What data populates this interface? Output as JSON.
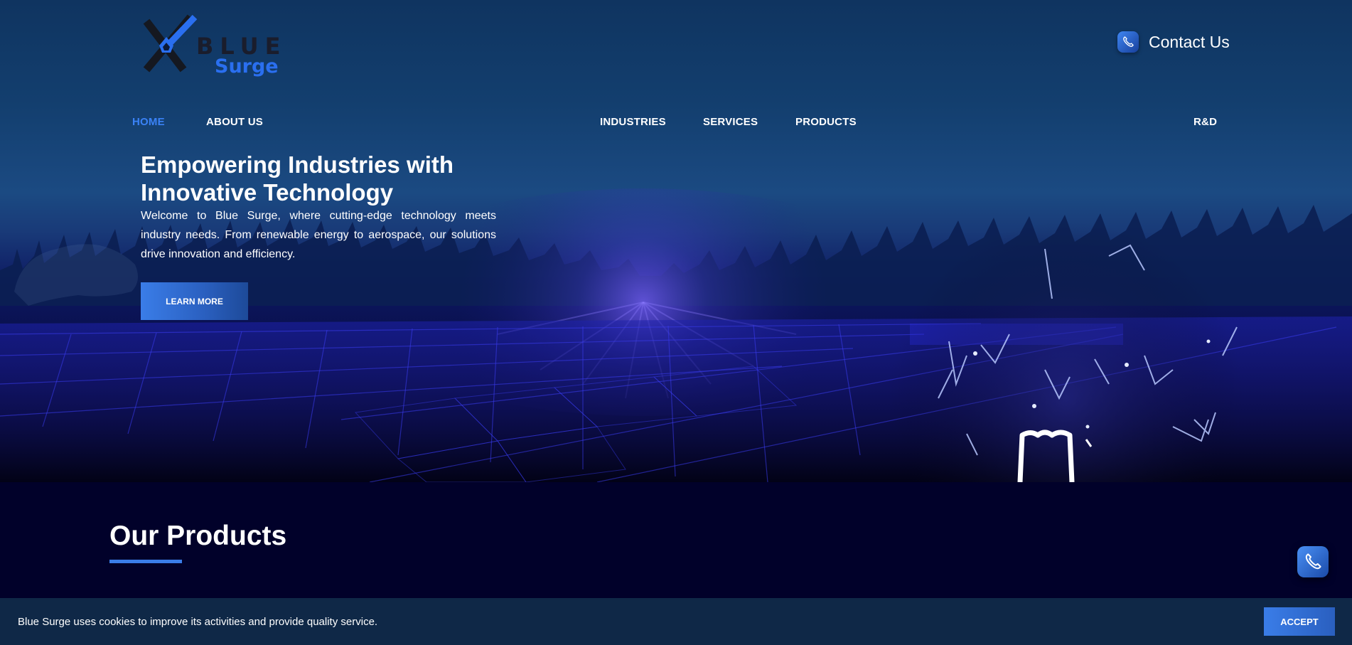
{
  "brand": {
    "word1": "BLUE",
    "word2": "Surge",
    "accent_color": "#2a6ff0",
    "dark_color": "#1a1d2c"
  },
  "header": {
    "contact_label": "Contact Us",
    "contact_icon": "phone-icon"
  },
  "nav": {
    "items": [
      {
        "label": "HOME",
        "active": true
      },
      {
        "label": "ABOUT US",
        "active": false
      },
      {
        "label": "INDUSTRIES",
        "active": false
      },
      {
        "label": "SERVICES",
        "active": false
      },
      {
        "label": "PRODUCTS",
        "active": false
      },
      {
        "label": "R&D",
        "active": false
      }
    ],
    "active_color": "#3a82f6"
  },
  "hero": {
    "title": "Empowering Industries with Innovative Technology",
    "text": "Welcome to Blue Surge, where cutting-edge technology meets industry needs. From renewable energy to aerospace, our solutions drive innovation and efficiency.",
    "cta_label": "LEARN MORE"
  },
  "products": {
    "title": "Our Products"
  },
  "floating_call": {
    "icon": "phone-icon"
  },
  "cookie": {
    "text": "Blue Surge uses cookies to improve its activities and provide quality service.",
    "accept_label": "ACCEPT"
  }
}
